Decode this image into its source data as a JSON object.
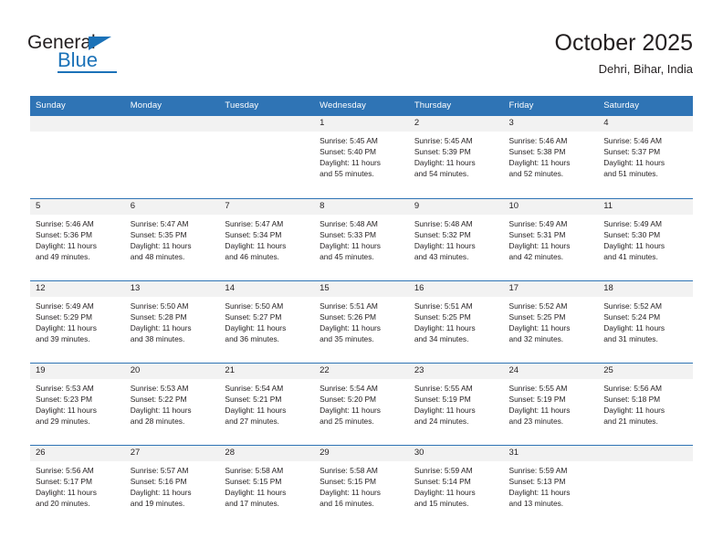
{
  "brand": {
    "name_part1": "General",
    "name_part2": "Blue",
    "triangle_icon": "blue-triangle-icon",
    "accent_color": "#1b72b8"
  },
  "header": {
    "title": "October 2025",
    "subtitle": "Dehri, Bihar, India"
  },
  "theme": {
    "header_blue": "#2f74b5",
    "band_gray": "#f2f2f2",
    "text": "#231f20"
  },
  "calendar": {
    "weekday_headers": [
      "Sunday",
      "Monday",
      "Tuesday",
      "Wednesday",
      "Thursday",
      "Friday",
      "Saturday"
    ],
    "weeks": [
      [
        {
          "day": "",
          "sunrise": "",
          "sunset": "",
          "daylight_line1": "",
          "daylight_line2": ""
        },
        {
          "day": "",
          "sunrise": "",
          "sunset": "",
          "daylight_line1": "",
          "daylight_line2": ""
        },
        {
          "day": "",
          "sunrise": "",
          "sunset": "",
          "daylight_line1": "",
          "daylight_line2": ""
        },
        {
          "day": "1",
          "sunrise": "Sunrise: 5:45 AM",
          "sunset": "Sunset: 5:40 PM",
          "daylight_line1": "Daylight: 11 hours",
          "daylight_line2": "and 55 minutes."
        },
        {
          "day": "2",
          "sunrise": "Sunrise: 5:45 AM",
          "sunset": "Sunset: 5:39 PM",
          "daylight_line1": "Daylight: 11 hours",
          "daylight_line2": "and 54 minutes."
        },
        {
          "day": "3",
          "sunrise": "Sunrise: 5:46 AM",
          "sunset": "Sunset: 5:38 PM",
          "daylight_line1": "Daylight: 11 hours",
          "daylight_line2": "and 52 minutes."
        },
        {
          "day": "4",
          "sunrise": "Sunrise: 5:46 AM",
          "sunset": "Sunset: 5:37 PM",
          "daylight_line1": "Daylight: 11 hours",
          "daylight_line2": "and 51 minutes."
        }
      ],
      [
        {
          "day": "5",
          "sunrise": "Sunrise: 5:46 AM",
          "sunset": "Sunset: 5:36 PM",
          "daylight_line1": "Daylight: 11 hours",
          "daylight_line2": "and 49 minutes."
        },
        {
          "day": "6",
          "sunrise": "Sunrise: 5:47 AM",
          "sunset": "Sunset: 5:35 PM",
          "daylight_line1": "Daylight: 11 hours",
          "daylight_line2": "and 48 minutes."
        },
        {
          "day": "7",
          "sunrise": "Sunrise: 5:47 AM",
          "sunset": "Sunset: 5:34 PM",
          "daylight_line1": "Daylight: 11 hours",
          "daylight_line2": "and 46 minutes."
        },
        {
          "day": "8",
          "sunrise": "Sunrise: 5:48 AM",
          "sunset": "Sunset: 5:33 PM",
          "daylight_line1": "Daylight: 11 hours",
          "daylight_line2": "and 45 minutes."
        },
        {
          "day": "9",
          "sunrise": "Sunrise: 5:48 AM",
          "sunset": "Sunset: 5:32 PM",
          "daylight_line1": "Daylight: 11 hours",
          "daylight_line2": "and 43 minutes."
        },
        {
          "day": "10",
          "sunrise": "Sunrise: 5:49 AM",
          "sunset": "Sunset: 5:31 PM",
          "daylight_line1": "Daylight: 11 hours",
          "daylight_line2": "and 42 minutes."
        },
        {
          "day": "11",
          "sunrise": "Sunrise: 5:49 AM",
          "sunset": "Sunset: 5:30 PM",
          "daylight_line1": "Daylight: 11 hours",
          "daylight_line2": "and 41 minutes."
        }
      ],
      [
        {
          "day": "12",
          "sunrise": "Sunrise: 5:49 AM",
          "sunset": "Sunset: 5:29 PM",
          "daylight_line1": "Daylight: 11 hours",
          "daylight_line2": "and 39 minutes."
        },
        {
          "day": "13",
          "sunrise": "Sunrise: 5:50 AM",
          "sunset": "Sunset: 5:28 PM",
          "daylight_line1": "Daylight: 11 hours",
          "daylight_line2": "and 38 minutes."
        },
        {
          "day": "14",
          "sunrise": "Sunrise: 5:50 AM",
          "sunset": "Sunset: 5:27 PM",
          "daylight_line1": "Daylight: 11 hours",
          "daylight_line2": "and 36 minutes."
        },
        {
          "day": "15",
          "sunrise": "Sunrise: 5:51 AM",
          "sunset": "Sunset: 5:26 PM",
          "daylight_line1": "Daylight: 11 hours",
          "daylight_line2": "and 35 minutes."
        },
        {
          "day": "16",
          "sunrise": "Sunrise: 5:51 AM",
          "sunset": "Sunset: 5:25 PM",
          "daylight_line1": "Daylight: 11 hours",
          "daylight_line2": "and 34 minutes."
        },
        {
          "day": "17",
          "sunrise": "Sunrise: 5:52 AM",
          "sunset": "Sunset: 5:25 PM",
          "daylight_line1": "Daylight: 11 hours",
          "daylight_line2": "and 32 minutes."
        },
        {
          "day": "18",
          "sunrise": "Sunrise: 5:52 AM",
          "sunset": "Sunset: 5:24 PM",
          "daylight_line1": "Daylight: 11 hours",
          "daylight_line2": "and 31 minutes."
        }
      ],
      [
        {
          "day": "19",
          "sunrise": "Sunrise: 5:53 AM",
          "sunset": "Sunset: 5:23 PM",
          "daylight_line1": "Daylight: 11 hours",
          "daylight_line2": "and 29 minutes."
        },
        {
          "day": "20",
          "sunrise": "Sunrise: 5:53 AM",
          "sunset": "Sunset: 5:22 PM",
          "daylight_line1": "Daylight: 11 hours",
          "daylight_line2": "and 28 minutes."
        },
        {
          "day": "21",
          "sunrise": "Sunrise: 5:54 AM",
          "sunset": "Sunset: 5:21 PM",
          "daylight_line1": "Daylight: 11 hours",
          "daylight_line2": "and 27 minutes."
        },
        {
          "day": "22",
          "sunrise": "Sunrise: 5:54 AM",
          "sunset": "Sunset: 5:20 PM",
          "daylight_line1": "Daylight: 11 hours",
          "daylight_line2": "and 25 minutes."
        },
        {
          "day": "23",
          "sunrise": "Sunrise: 5:55 AM",
          "sunset": "Sunset: 5:19 PM",
          "daylight_line1": "Daylight: 11 hours",
          "daylight_line2": "and 24 minutes."
        },
        {
          "day": "24",
          "sunrise": "Sunrise: 5:55 AM",
          "sunset": "Sunset: 5:19 PM",
          "daylight_line1": "Daylight: 11 hours",
          "daylight_line2": "and 23 minutes."
        },
        {
          "day": "25",
          "sunrise": "Sunrise: 5:56 AM",
          "sunset": "Sunset: 5:18 PM",
          "daylight_line1": "Daylight: 11 hours",
          "daylight_line2": "and 21 minutes."
        }
      ],
      [
        {
          "day": "26",
          "sunrise": "Sunrise: 5:56 AM",
          "sunset": "Sunset: 5:17 PM",
          "daylight_line1": "Daylight: 11 hours",
          "daylight_line2": "and 20 minutes."
        },
        {
          "day": "27",
          "sunrise": "Sunrise: 5:57 AM",
          "sunset": "Sunset: 5:16 PM",
          "daylight_line1": "Daylight: 11 hours",
          "daylight_line2": "and 19 minutes."
        },
        {
          "day": "28",
          "sunrise": "Sunrise: 5:58 AM",
          "sunset": "Sunset: 5:15 PM",
          "daylight_line1": "Daylight: 11 hours",
          "daylight_line2": "and 17 minutes."
        },
        {
          "day": "29",
          "sunrise": "Sunrise: 5:58 AM",
          "sunset": "Sunset: 5:15 PM",
          "daylight_line1": "Daylight: 11 hours",
          "daylight_line2": "and 16 minutes."
        },
        {
          "day": "30",
          "sunrise": "Sunrise: 5:59 AM",
          "sunset": "Sunset: 5:14 PM",
          "daylight_line1": "Daylight: 11 hours",
          "daylight_line2": "and 15 minutes."
        },
        {
          "day": "31",
          "sunrise": "Sunrise: 5:59 AM",
          "sunset": "Sunset: 5:13 PM",
          "daylight_line1": "Daylight: 11 hours",
          "daylight_line2": "and 13 minutes."
        },
        {
          "day": "",
          "sunrise": "",
          "sunset": "",
          "daylight_line1": "",
          "daylight_line2": ""
        }
      ]
    ]
  }
}
